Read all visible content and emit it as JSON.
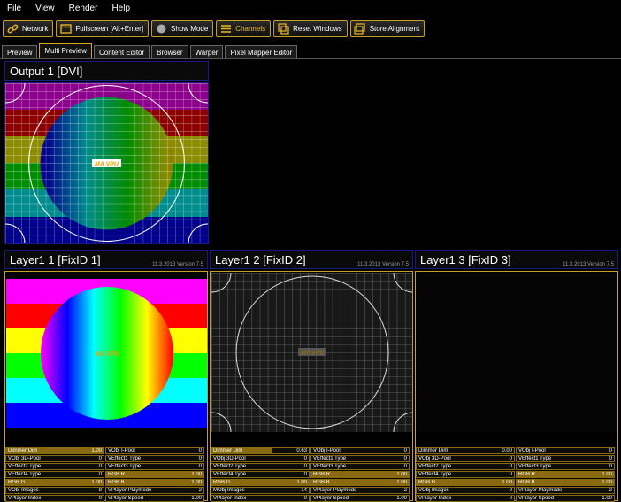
{
  "menu": [
    "File",
    "View",
    "Render",
    "Help"
  ],
  "toolbar": [
    {
      "label": "Network",
      "icon": "chain-link-icon"
    },
    {
      "label": "Fullscreen [Alt+Enter]",
      "icon": "window-icon"
    },
    {
      "label": "Show Mode",
      "icon": "circle-icon"
    },
    {
      "label": "Channels",
      "icon": "channels-icon",
      "active": true
    },
    {
      "label": "Reset Windows",
      "icon": "windows-icon"
    },
    {
      "label": "Store Alignment",
      "icon": "store-icon"
    }
  ],
  "tabs": [
    "Preview",
    "Multi Preview",
    "Content Editor",
    "Browser",
    "Warper",
    "Pixel Mapper Editor"
  ],
  "active_tab": "Multi Preview",
  "output": {
    "title": "Output 1 [DVI]",
    "watermark": "MA VPU"
  },
  "layers": [
    {
      "title": "Layer1 1 [FixID 1]",
      "version": "11.3.2013  Version  7.5",
      "watermark": "MA VPU",
      "left": [
        {
          "label": "Dimmer Dim",
          "value": "1.00",
          "level": 1.0
        },
        {
          "label": "VObj 3D-Pool",
          "value": "0"
        },
        {
          "label": "VEffect2 Type",
          "value": "0"
        },
        {
          "label": "VEffect4 Type",
          "value": "0"
        },
        {
          "label": "RGB G",
          "value": "1.00",
          "level": 1.0
        },
        {
          "label": "VObj Images",
          "value": "9"
        },
        {
          "label": "VPlayer Index",
          "value": "0"
        }
      ],
      "right": [
        {
          "label": "VObj I-Pool",
          "value": "0"
        },
        {
          "label": "VEffect1 Type",
          "value": "0"
        },
        {
          "label": "VEffect3 Type",
          "value": "0"
        },
        {
          "label": "RGB R",
          "value": "1.00",
          "level": 1.0
        },
        {
          "label": "RGB B",
          "value": "1.00",
          "level": 1.0
        },
        {
          "label": "VPlayer Playmode",
          "value": "2"
        },
        {
          "label": "VPlayer Speed",
          "value": "1.00"
        }
      ]
    },
    {
      "title": "Layer1 2 [FixID 2]",
      "version": "11.3.2013  Version  7.5",
      "watermark": "MA VPU",
      "left": [
        {
          "label": "Dimmer Dim",
          "value": "0.63",
          "level": 0.63
        },
        {
          "label": "VObj 3D-Pool",
          "value": "0"
        },
        {
          "label": "VEffect2 Type",
          "value": "0"
        },
        {
          "label": "VEffect4 Type",
          "value": "0"
        },
        {
          "label": "RGB G",
          "value": "1.00",
          "level": 1.0
        },
        {
          "label": "MObj Images",
          "value": "14"
        },
        {
          "label": "VPlayer Index",
          "value": "0"
        }
      ],
      "right": [
        {
          "label": "VObj I-Pool",
          "value": "0"
        },
        {
          "label": "VEffect1 Type",
          "value": "0"
        },
        {
          "label": "VEffect3 Type",
          "value": "0"
        },
        {
          "label": "RGB R",
          "value": "1.00",
          "level": 1.0
        },
        {
          "label": "RGB B",
          "value": "1.00",
          "level": 1.0
        },
        {
          "label": "VPlayer Playmode",
          "value": "2"
        },
        {
          "label": "VPlayer Speed",
          "value": "1.00"
        }
      ]
    },
    {
      "title": "Layer1 3 [FixID 3]",
      "version": "11.3.2013  Version  7.5",
      "watermark": "",
      "left": [
        {
          "label": "Dimmer Dim",
          "value": "0.00",
          "level": 0.0
        },
        {
          "label": "VObj 3D-Pool",
          "value": "0"
        },
        {
          "label": "VEffect2 Type",
          "value": "0"
        },
        {
          "label": "VEffect4 Type",
          "value": "0"
        },
        {
          "label": "RGB G",
          "value": "1.00",
          "level": 1.0
        },
        {
          "label": "VObj Images",
          "value": "0"
        },
        {
          "label": "VPlayer Index",
          "value": "0"
        }
      ],
      "right": [
        {
          "label": "VObj I-Pool",
          "value": "0"
        },
        {
          "label": "VEffect1 Type",
          "value": "0"
        },
        {
          "label": "VEffect3 Type",
          "value": "0"
        },
        {
          "label": "RGB R",
          "value": "1.00",
          "level": 1.0
        },
        {
          "label": "RGB B",
          "value": "1.00",
          "level": 1.0
        },
        {
          "label": "VPlayer Playmode",
          "value": "2"
        },
        {
          "label": "VPlayer Speed",
          "value": "1.00"
        }
      ]
    }
  ],
  "colors": {
    "accent": "#c8a020",
    "panel_border": "#1a1a80"
  }
}
